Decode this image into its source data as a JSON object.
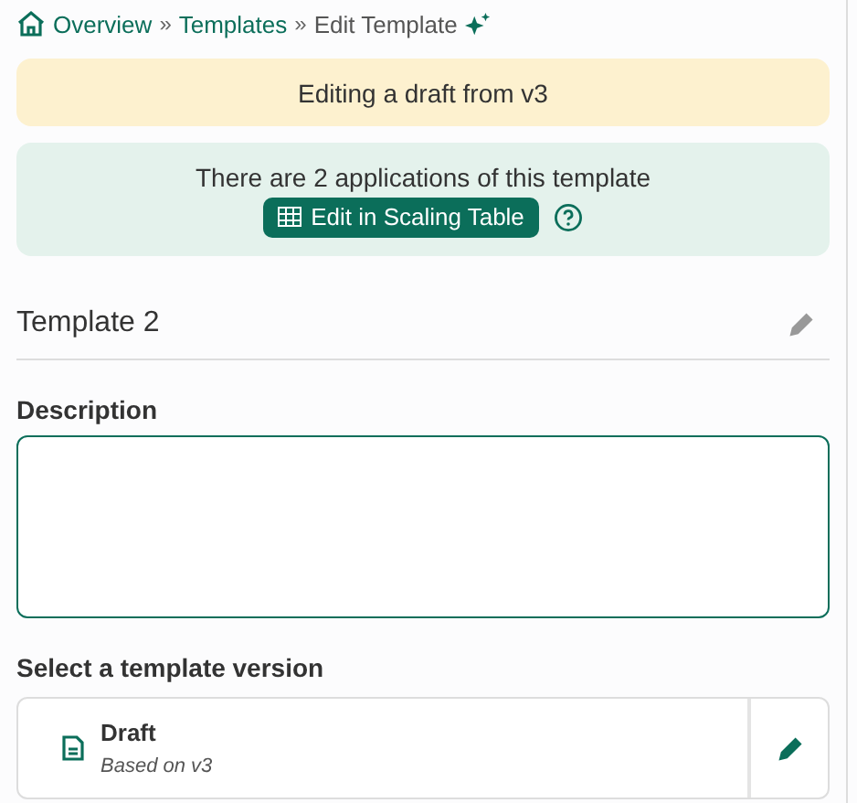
{
  "breadcrumb": [
    {
      "label": "Overview",
      "kind": "link"
    },
    {
      "label": "»",
      "kind": "separator"
    },
    {
      "label": "Templates",
      "kind": "link"
    },
    {
      "label": "»",
      "kind": "separator"
    },
    {
      "label": "Edit Template",
      "kind": "current"
    }
  ],
  "draft_banner": {
    "text": "Editing a draft from v3"
  },
  "applications_banner": {
    "text": "There are 2 applications of this template",
    "button": "Edit in Scaling Table"
  },
  "template_name": "Template 2",
  "description": {
    "label": "Description"
  },
  "versions": {
    "label": "Select a template version",
    "items": [
      {
        "title": "Draft",
        "subtitle": "Based on v3"
      }
    ]
  }
}
